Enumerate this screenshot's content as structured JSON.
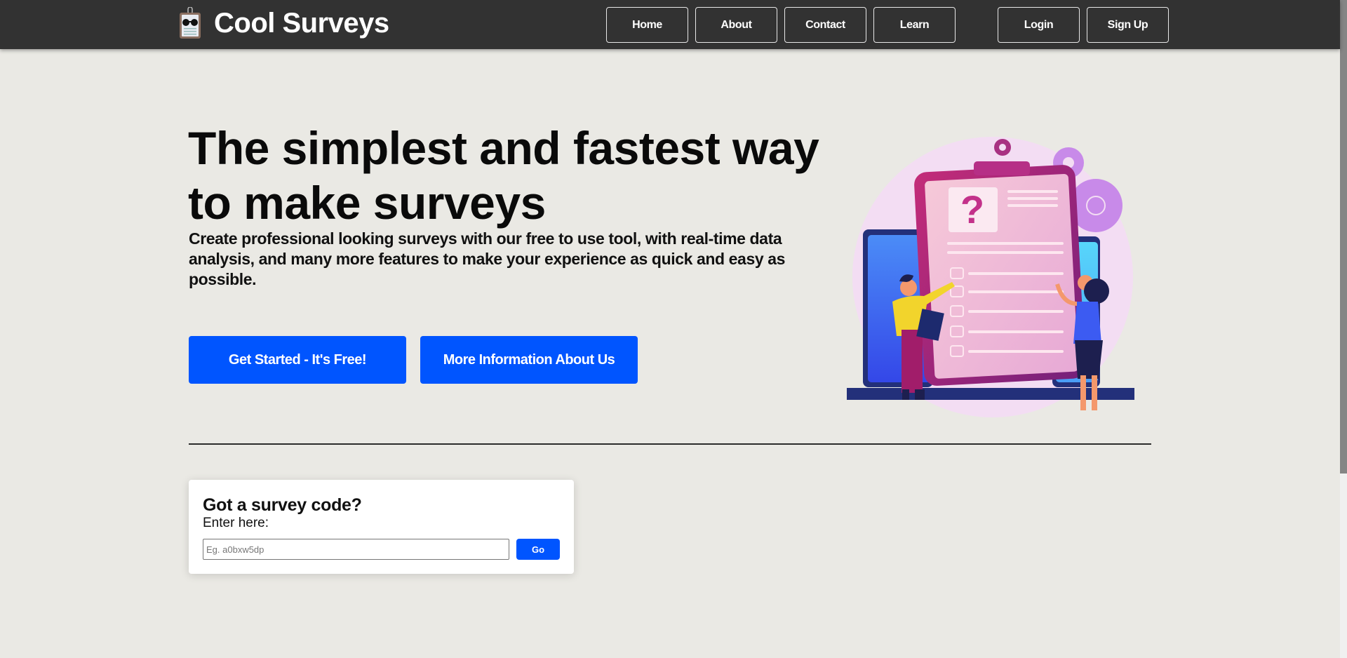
{
  "brand": {
    "title": "Cool Surveys",
    "logo_icon": "clipboard-sunglasses-icon"
  },
  "nav": {
    "items": [
      {
        "label": "Home"
      },
      {
        "label": "About"
      },
      {
        "label": "Contact"
      },
      {
        "label": "Learn"
      }
    ],
    "auth": [
      {
        "label": "Login"
      },
      {
        "label": "Sign Up"
      }
    ]
  },
  "hero": {
    "title": "The simplest and fastest way to make surveys",
    "subtitle": "Create professional looking surveys with our free to use tool, with real-time data analysis, and many more features to make your experience as quick and easy as possible.",
    "primary_cta": "Get Started - It's Free!",
    "secondary_cta": "More Information About Us",
    "illustration": "survey-clipboard-illustration"
  },
  "survey_code": {
    "title": "Got a survey code?",
    "label": "Enter here:",
    "placeholder": "Eg. a0bxw5dp",
    "value": "",
    "go_label": "Go"
  },
  "colors": {
    "navbar": "#323232",
    "background": "#eae9e4",
    "accent": "#0055ff"
  }
}
